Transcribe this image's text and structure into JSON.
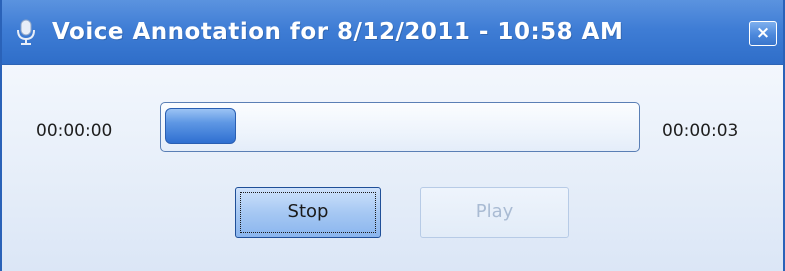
{
  "window": {
    "title": "Voice Annotation for 8/12/2011 - 10:58 AM",
    "title_icon": "microphone-icon",
    "close_label": "×",
    "close_icon": "close-icon"
  },
  "playback": {
    "elapsed_time": "00:00:00",
    "total_time": "00:00:03",
    "progress_fraction": 0.15
  },
  "buttons": {
    "stop_label": "Stop",
    "stop_enabled": true,
    "stop_focused": true,
    "play_label": "Play",
    "play_enabled": false
  },
  "colors": {
    "titlebar": "#3f7dd5",
    "progress_fill": "#3a79d8",
    "disabled_text": "#a9bbd3"
  }
}
